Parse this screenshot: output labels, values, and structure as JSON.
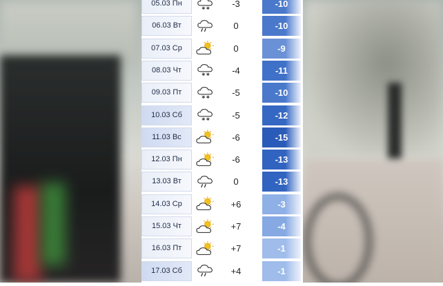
{
  "forecast": [
    {
      "date": "05.03 Пн",
      "icon": "snow-icon",
      "day": "-3",
      "night": "-10",
      "weekend": false,
      "color": "#4a79cc"
    },
    {
      "date": "06.03 Вт",
      "icon": "rain-icon",
      "day": "0",
      "night": "-10",
      "weekend": false,
      "color": "#4a79cc"
    },
    {
      "date": "07.03 Ср",
      "icon": "partly-cloudy-icon",
      "day": "0",
      "night": "-9",
      "weekend": false,
      "color": "#6a91d6"
    },
    {
      "date": "08.03 Чт",
      "icon": "snow-icon",
      "day": "-4",
      "night": "-11",
      "weekend": false,
      "color": "#3f71c8"
    },
    {
      "date": "09.03 Пт",
      "icon": "snow-icon",
      "day": "-5",
      "night": "-10",
      "weekend": false,
      "color": "#4a79cc"
    },
    {
      "date": "10.03 Сб",
      "icon": "snow-icon",
      "day": "-5",
      "night": "-12",
      "weekend": true,
      "color": "#3568c3"
    },
    {
      "date": "11.03 Вс",
      "icon": "partly-cloudy-icon",
      "day": "-6",
      "night": "-15",
      "weekend": true,
      "color": "#2a5bb8"
    },
    {
      "date": "12.03 Пн",
      "icon": "partly-cloudy-icon",
      "day": "-6",
      "night": "-13",
      "weekend": false,
      "color": "#3164c0"
    },
    {
      "date": "13.03 Вт",
      "icon": "rain-icon",
      "day": "0",
      "night": "-13",
      "weekend": false,
      "color": "#3164c0"
    },
    {
      "date": "14.03 Ср",
      "icon": "partly-cloudy-icon",
      "day": "+6",
      "night": "-3",
      "weekend": false,
      "color": "#8fb0e6"
    },
    {
      "date": "15.03 Чт",
      "icon": "partly-cloudy-icon",
      "day": "+7",
      "night": "-4",
      "weekend": false,
      "color": "#86a9e3"
    },
    {
      "date": "16.03 Пт",
      "icon": "partly-cloudy-icon",
      "day": "+7",
      "night": "-1",
      "weekend": false,
      "color": "#9fbcea"
    },
    {
      "date": "17.03 Сб",
      "icon": "rain-icon",
      "day": "+4",
      "night": "-1",
      "weekend": true,
      "color": "#9fbcea"
    }
  ]
}
